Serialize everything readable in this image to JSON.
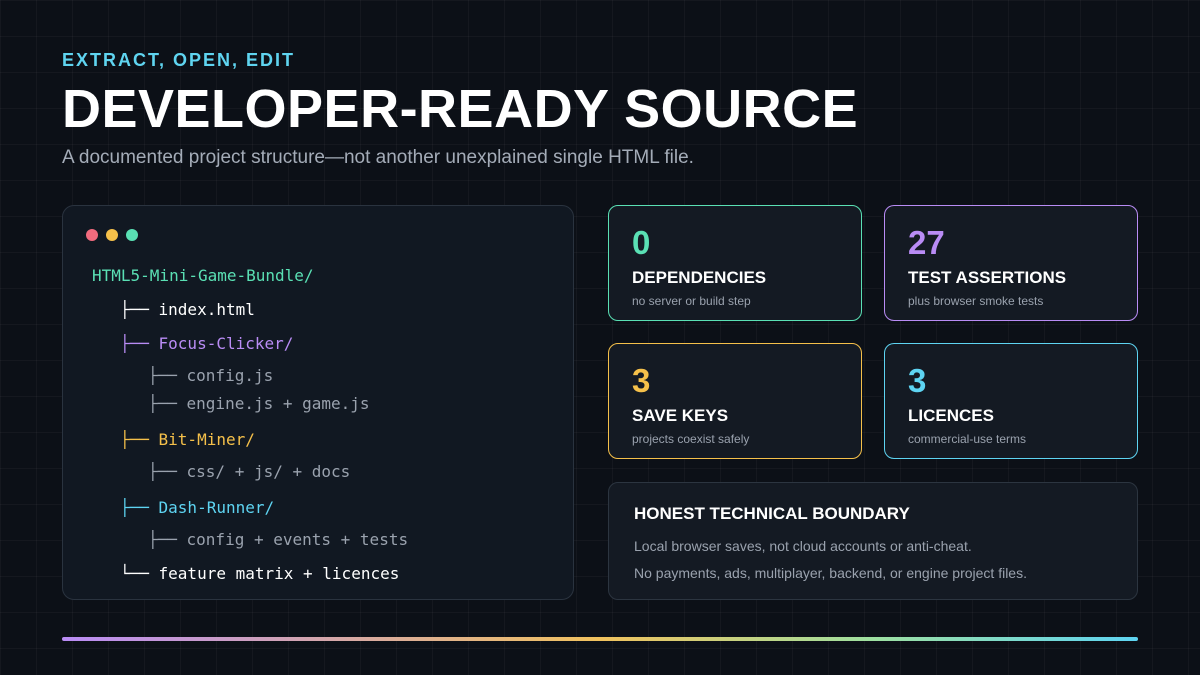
{
  "header": {
    "eyebrow": "EXTRACT, OPEN, EDIT",
    "title": "DEVELOPER-READY SOURCE",
    "subtitle": "A documented project structure—not another unexplained single HTML file."
  },
  "terminal": {
    "window_dots": [
      "red",
      "yellow",
      "green"
    ],
    "tree": [
      {
        "branch": "",
        "text": "HTML5-Mini-Game-Bundle/",
        "color": "#5ae0b4"
      },
      {
        "branch": "├── ",
        "text": "index.html",
        "color": "#ffffff"
      },
      {
        "branch": "├── ",
        "text": "Focus-Clicker/",
        "color": "#b98cf5"
      },
      {
        "branch": "├── ",
        "text": "config.js",
        "color": "#9aa2ae"
      },
      {
        "branch": "├── ",
        "text": "engine.js + game.js",
        "color": "#9aa2ae"
      },
      {
        "branch": "├── ",
        "text": "Bit-Miner/",
        "color": "#f5c04a"
      },
      {
        "branch": "├── ",
        "text": "css/ + js/ + docs",
        "color": "#9aa2ae"
      },
      {
        "branch": "├── ",
        "text": "Dash-Runner/",
        "color": "#5ed4f2"
      },
      {
        "branch": "├── ",
        "text": "config + events + tests",
        "color": "#9aa2ae"
      },
      {
        "branch": "└── ",
        "text": "feature matrix + licences",
        "color": "#ffffff"
      }
    ]
  },
  "stats": [
    {
      "number": "0",
      "label": "DEPENDENCIES",
      "desc": "no server or build step",
      "color": "#5ae0b4"
    },
    {
      "number": "27",
      "label": "TEST ASSERTIONS",
      "desc": "plus browser smoke tests",
      "color": "#b98cf5"
    },
    {
      "number": "3",
      "label": "SAVE KEYS",
      "desc": "projects coexist safely",
      "color": "#f5c04a"
    },
    {
      "number": "3",
      "label": "LICENCES",
      "desc": "commercial-use terms",
      "color": "#5ed4f2"
    }
  ],
  "boundary": {
    "title": "HONEST TECHNICAL BOUNDARY",
    "lines": [
      "Local browser saves, not cloud accounts or anti-cheat.",
      "No payments, ads, multiplayer, backend, or engine project files."
    ]
  }
}
